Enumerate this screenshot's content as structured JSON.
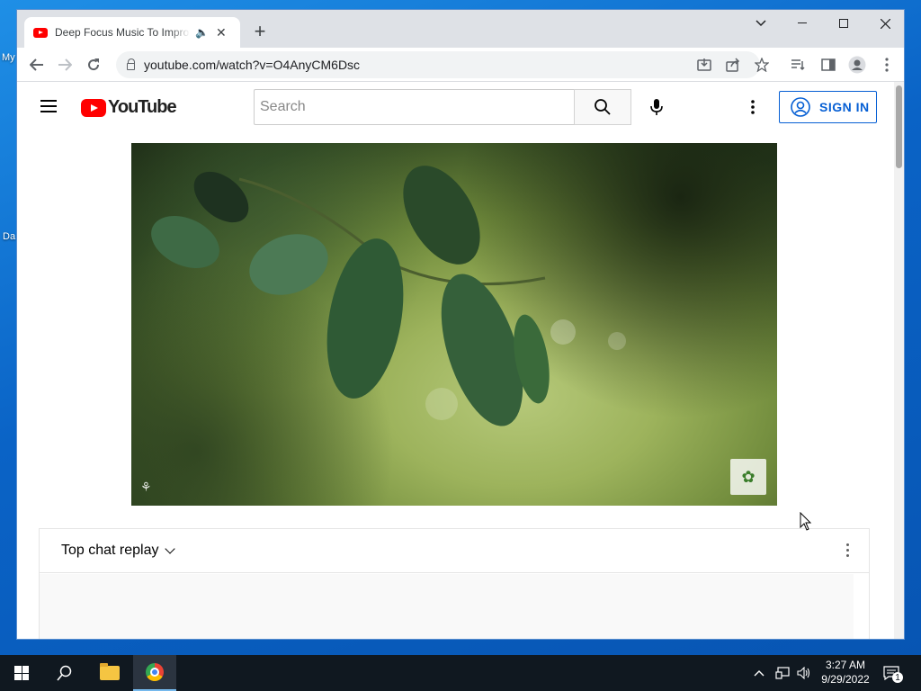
{
  "browser": {
    "tab_title": "Deep Focus Music To Improve Concentration",
    "tab_close": "✕",
    "new_tab": "+",
    "url": "youtube.com/watch?v=O4AnyCM6Dsc"
  },
  "desktop": {
    "frag1": "My",
    "frag2": "Da"
  },
  "youtube": {
    "logo_text": "YouTube",
    "search_placeholder": "Search",
    "sign_in": "SIGN IN"
  },
  "chat": {
    "title": "Top chat replay"
  },
  "taskbar": {
    "time": "3:27 AM",
    "date": "9/29/2022",
    "notification_count": "1"
  },
  "icons": {
    "tab": [
      "youtube-favicon",
      "speaker-icon",
      "close-icon"
    ],
    "toolbar": [
      "back-icon",
      "forward-icon",
      "reload-icon",
      "lock-icon",
      "install-icon",
      "share-icon",
      "star-icon",
      "reading-list-icon",
      "side-panel-icon",
      "profile-icon",
      "kebab-icon"
    ],
    "taskbar": [
      "windows-start-icon",
      "search-icon",
      "file-explorer-icon",
      "chrome-icon",
      "chevron-up-icon",
      "network-icon",
      "volume-icon",
      "notification-icon"
    ]
  },
  "colors": {
    "youtube_red": "#ff0000",
    "sign_in_blue": "#065fd4",
    "taskbar": "#101820",
    "desktop": "#0a63c6"
  }
}
